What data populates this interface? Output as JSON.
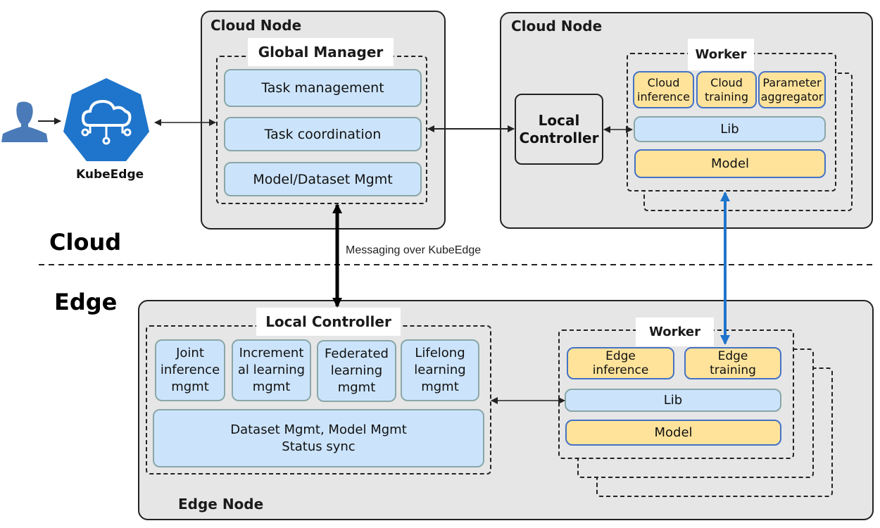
{
  "zones": {
    "cloud": "Cloud",
    "edge": "Edge"
  },
  "messaging_label": "Messaging over KubeEdge",
  "user": {
    "icon": "user-icon"
  },
  "kubeedge": {
    "label": "KubeEdge",
    "icon": "kubeedge-logo-icon",
    "color": "#1f75cb"
  },
  "cloud_node_left": {
    "title": "Cloud Node",
    "global_manager": {
      "title": "Global Manager",
      "items": [
        "Task management",
        "Task coordination",
        "Model/Dataset Mgmt"
      ]
    }
  },
  "cloud_node_right": {
    "title": "Cloud Node",
    "local_controller": "Local\nController",
    "worker": {
      "title": "Worker",
      "modules": [
        "Cloud\ninference",
        "Cloud\ntraining",
        "Parameter\naggregator"
      ],
      "lib": "Lib",
      "model": "Model"
    }
  },
  "edge_node": {
    "title": "Edge Node",
    "local_controller": {
      "title": "Local Controller",
      "modules": [
        "Joint\ninference\nmgmt",
        "Increment\nal learning\nmgmt",
        "Federated\nlearning\nmgmt",
        "Lifelong\nlearning\nmgmt"
      ],
      "shared": "Dataset Mgmt, Model Mgmt\nStatus sync"
    },
    "worker": {
      "title": "Worker",
      "modules": [
        "Edge\ninference",
        "Edge\ntraining"
      ],
      "lib": "Lib",
      "model": "Model"
    }
  },
  "colors": {
    "node_bg": "#e6e6e6",
    "blue_box": "#cce4fb",
    "yellow_box": "#ffe39b",
    "yellow_border": "#4472c4",
    "blue_arrow": "#1f75cb"
  }
}
